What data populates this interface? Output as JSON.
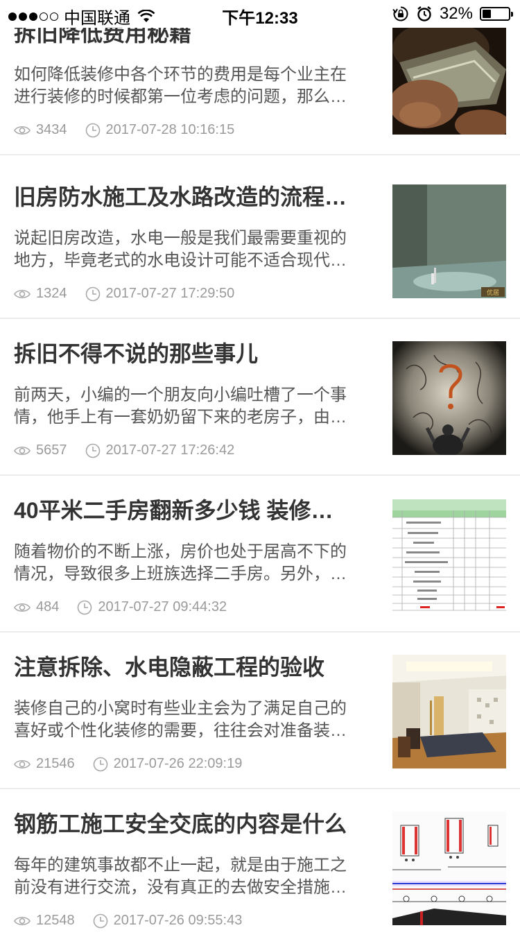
{
  "status_bar": {
    "carrier": "中国联通",
    "time": "下午12:33",
    "battery_text": "32%",
    "battery_level": 0.32
  },
  "articles": [
    {
      "title": "拆旧降低费用秘籍",
      "desc": "如何降低装修中各个环节的费用是每个业主在进行装修的时候都第一位考虑的问题，那么…",
      "views": "3434",
      "time": "2017-07-28 10:16:15",
      "image": "money-in-hands-photo"
    },
    {
      "title": "旧房防水施工及水路改造的流程…",
      "desc": "说起旧房改造，水电一般是我们最需要重视的地方，毕竟老式的水电设计可能不适合现代…",
      "views": "1324",
      "time": "2017-07-27 17:29:50",
      "image": "waterproofing-room-photo",
      "image_watermark": "优居"
    },
    {
      "title": "拆旧不得不说的那些事儿",
      "desc": "前两天，小编的一个朋友向小编吐槽了一个事情，他手上有一套奶奶留下来的老房子，由…",
      "views": "5657",
      "time": "2017-07-27 17:26:42",
      "image": "question-mark-wall-photo"
    },
    {
      "title": "40平米二手房翻新多少钱 装修…",
      "desc": "随着物价的不断上涨，房价也处于居高不下的情况，导致很多上班族选择二手房。另外，…",
      "views": "484",
      "time": "2017-07-27 09:44:32",
      "image": "renovation-budget-table"
    },
    {
      "title": "注意拆除、水电隐蔽工程的验收",
      "desc": "装修自己的小窝时有些业主会为了满足自己的喜好或个性化装修的需要，往往会对准备装…",
      "views": "21546",
      "time": "2017-07-26 22:09:19",
      "image": "bedroom-interior-photo"
    },
    {
      "title": "钢筋工施工安全交底的内容是什么",
      "desc": "每年的建筑事故都不止一起，就是由于施工之前没有进行交流，没有真正的去做安全措施…",
      "views": "12548",
      "time": "2017-07-26 09:55:43",
      "image": "rebar-construction-drawing"
    }
  ]
}
